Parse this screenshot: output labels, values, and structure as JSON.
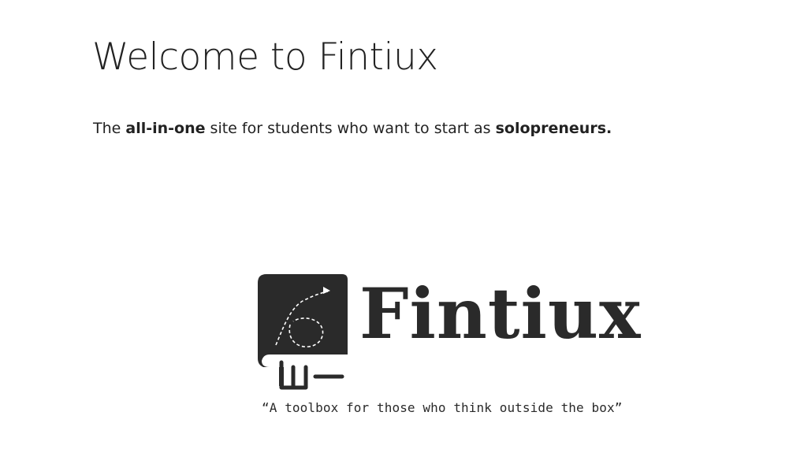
{
  "page": {
    "title": "Welcome to Fintiux",
    "intro": {
      "part1": "The ",
      "bold1": "all-in-one",
      "part2": " site for students who want to start as ",
      "bold2": "solopreneurs."
    }
  },
  "logo": {
    "brand_name": "Fintiux",
    "tagline": "“A toolbox for those who think outside the box”",
    "icon": "book-with-dashed-arrow-icon",
    "color": "#2a2a2a"
  }
}
